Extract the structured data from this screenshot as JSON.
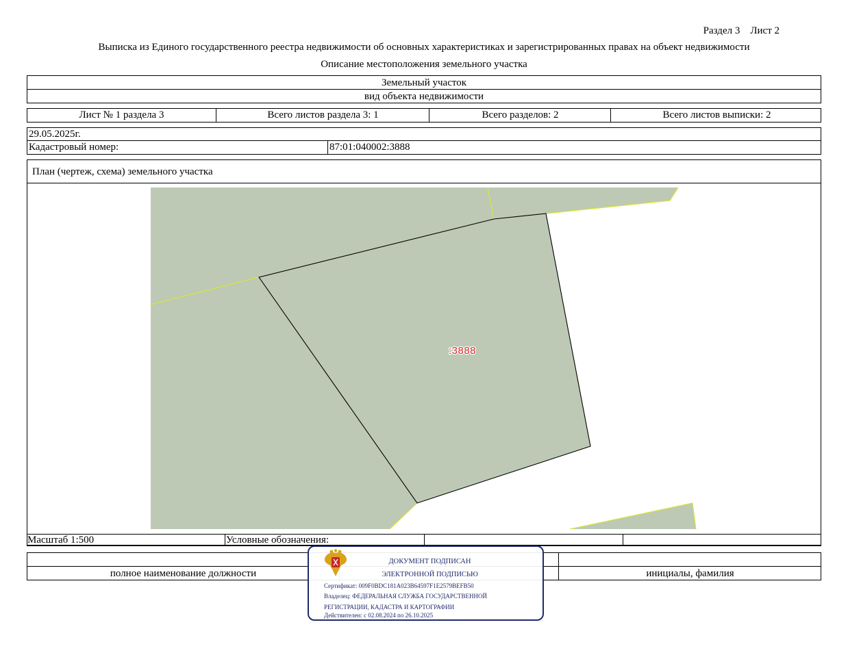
{
  "header": {
    "section_sheet": "Раздел 3    Лист 2",
    "title": "Выписка из Единого государственного реестра недвижимости об основных характеристиках и зарегистрированных правах на объект недвижимости",
    "subtitle": "Описание местоположения земельного участка"
  },
  "object": {
    "type": "Земельный участок",
    "type_caption": "вид объекта недвижимости"
  },
  "sheets": {
    "sheet_of_section": "Лист № 1 раздела 3",
    "total_sheets_section": "Всего листов раздела 3: 1",
    "total_sections": "Всего разделов: 2",
    "total_sheets_extract": "Всего листов выписки: 2"
  },
  "record": {
    "date": "29.05.2025г.",
    "cadastral_label": "Кадастровый номер:",
    "cadastral_number": "87:01:040002:3888"
  },
  "plan": {
    "heading": "План (чертеж, схема) земельного участка",
    "parcel_label": ":3888",
    "colors": {
      "parcel_fill": "#bdc9b4",
      "neighbor_border": "#d8e63a",
      "parcel_border": "#000000",
      "parcel_label": "#d42a2a"
    }
  },
  "footer": {
    "scale": "Масштаб 1:500",
    "legend_label": "Условные обозначения:",
    "position_caption": "полное наименование должности",
    "name_caption": "инициалы, фамилия"
  },
  "signature_stamp": {
    "line1": "ДОКУМЕНТ ПОДПИСАН",
    "line2": "ЭЛЕКТРОННОЙ ПОДПИСЬЮ",
    "certificate": "Сертификат: 009F0BDC181A023B64597F1E2579BEFB50",
    "owner_line1": "Владелец: ФЕДЕРАЛЬНАЯ СЛУЖБА ГОСУДАРСТВЕННОЙ",
    "owner_line2": "РЕГИСТРАЦИИ, КАДАСТРА И КАРТОГРАФИИ",
    "validity": "Действителен: с 02.08.2024 по 26.10.2025",
    "emblem_icon": "coat-of-arms-icon",
    "color": "#1f2a6b"
  }
}
